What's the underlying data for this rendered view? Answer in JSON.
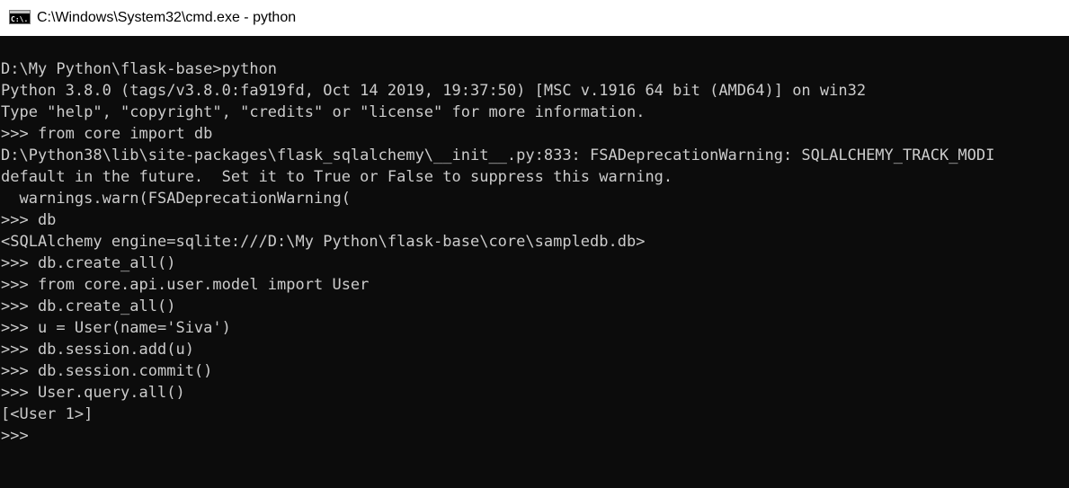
{
  "window": {
    "title": "C:\\Windows\\System32\\cmd.exe - python",
    "icon": "cmd-icon",
    "icon_text": "C:\\."
  },
  "colors": {
    "console_bg": "#0c0c0c",
    "console_fg": "#cccccc",
    "titlebar_bg": "#ffffff"
  },
  "console": {
    "lines": [
      "D:\\My Python\\flask-base>python",
      "Python 3.8.0 (tags/v3.8.0:fa919fd, Oct 14 2019, 19:37:50) [MSC v.1916 64 bit (AMD64)] on win32",
      "Type \"help\", \"copyright\", \"credits\" or \"license\" for more information.",
      ">>> from core import db",
      "D:\\Python38\\lib\\site-packages\\flask_sqlalchemy\\__init__.py:833: FSADeprecationWarning: SQLALCHEMY_TRACK_MODI",
      "default in the future.  Set it to True or False to suppress this warning.",
      "  warnings.warn(FSADeprecationWarning(",
      ">>> db",
      "<SQLAlchemy engine=sqlite:///D:\\My Python\\flask-base\\core\\sampledb.db>",
      ">>> db.create_all()",
      ">>> from core.api.user.model import User",
      ">>> db.create_all()",
      ">>> u = User(name='Siva')",
      ">>> db.session.add(u)",
      ">>> db.session.commit()",
      ">>> User.query.all()",
      "[<User 1>]",
      ">>>"
    ]
  }
}
